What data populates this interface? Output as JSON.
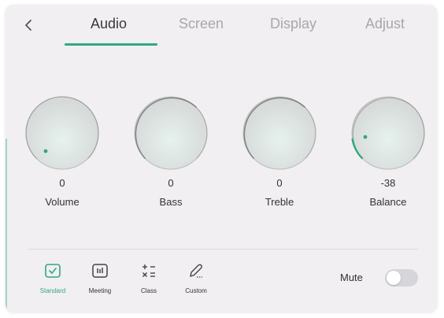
{
  "header": {
    "back_icon": "chevron-left-icon",
    "tabs": [
      {
        "label": "Audio",
        "active": true
      },
      {
        "label": "Screen",
        "active": false
      },
      {
        "label": "Display",
        "active": false
      },
      {
        "label": "Adjust",
        "active": false
      }
    ]
  },
  "knobs": [
    {
      "label": "Volume",
      "value": "0"
    },
    {
      "label": "Bass",
      "value": "0"
    },
    {
      "label": "Treble",
      "value": "0"
    },
    {
      "label": "Balance",
      "value": "-38"
    }
  ],
  "modes": [
    {
      "label": "Standard",
      "icon": "check-square-icon",
      "active": true
    },
    {
      "label": "Meeting",
      "icon": "equalizer-icon",
      "active": false
    },
    {
      "label": "Class",
      "icon": "calculator-icon",
      "active": false
    },
    {
      "label": "Custom",
      "icon": "pencil-icon",
      "active": false
    }
  ],
  "mute": {
    "label": "Mute",
    "on": false
  },
  "colors": {
    "accent": "#2fa87f",
    "panel_bg": "#f1eff1",
    "text": "#333333",
    "inactive_tab": "#a9a7ab"
  }
}
